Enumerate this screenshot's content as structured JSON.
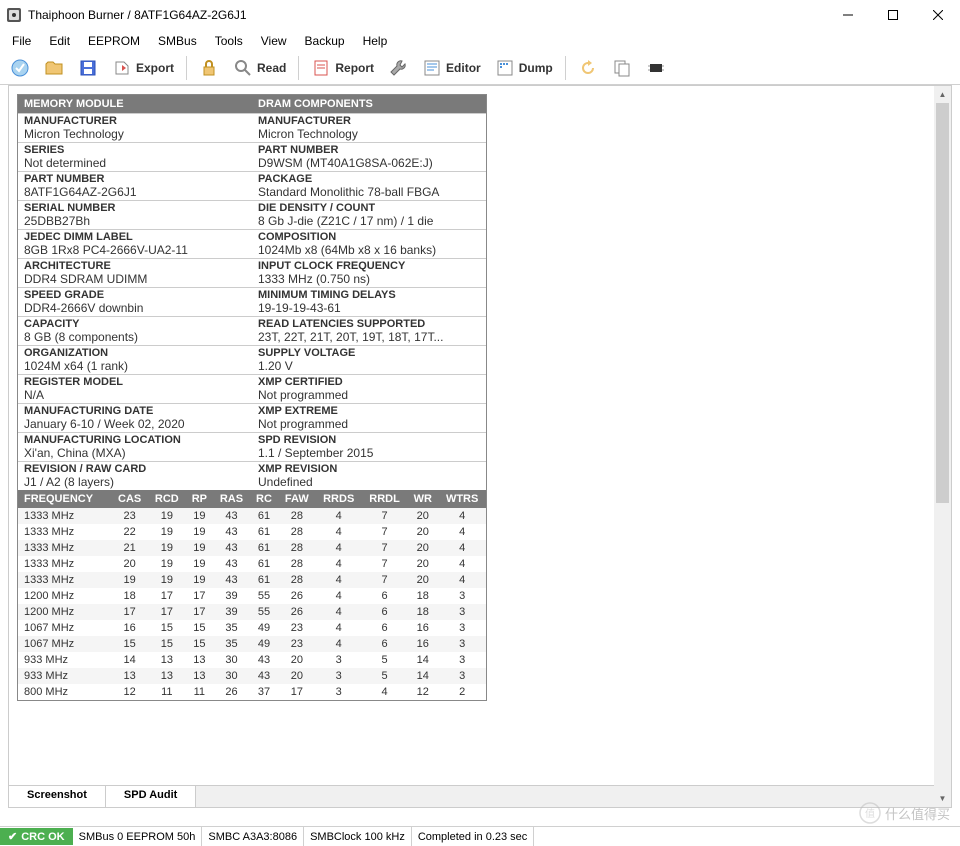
{
  "window": {
    "title": "Thaiphoon Burner / 8ATF1G64AZ-2G6J1"
  },
  "menu": [
    "File",
    "Edit",
    "EEPROM",
    "SMBus",
    "Tools",
    "View",
    "Backup",
    "Help"
  ],
  "toolbar": {
    "export_label": "Export",
    "read_label": "Read",
    "report_label": "Report",
    "editor_label": "Editor",
    "dump_label": "Dump"
  },
  "headers": {
    "memory_module": "MEMORY MODULE",
    "dram_components": "DRAM COMPONENTS"
  },
  "module": {
    "manufacturer": {
      "label": "MANUFACTURER",
      "value": "Micron Technology"
    },
    "series": {
      "label": "SERIES",
      "value": "Not determined"
    },
    "part_number": {
      "label": "PART NUMBER",
      "value": "8ATF1G64AZ-2G6J1"
    },
    "serial_number": {
      "label": "SERIAL NUMBER",
      "value": "25DBB27Bh"
    },
    "jedec_dimm_label": {
      "label": "JEDEC DIMM LABEL",
      "value": "8GB 1Rx8 PC4-2666V-UA2-11"
    },
    "architecture": {
      "label": "ARCHITECTURE",
      "value": "DDR4 SDRAM UDIMM"
    },
    "speed_grade": {
      "label": "SPEED GRADE",
      "value": "DDR4-2666V downbin"
    },
    "capacity": {
      "label": "CAPACITY",
      "value": "8 GB (8 components)"
    },
    "organization": {
      "label": "ORGANIZATION",
      "value": "1024M x64 (1 rank)"
    },
    "register_model": {
      "label": "REGISTER MODEL",
      "value": "N/A"
    },
    "manufacturing_date": {
      "label": "MANUFACTURING DATE",
      "value": "January 6-10 / Week 02, 2020"
    },
    "manufacturing_location": {
      "label": "MANUFACTURING LOCATION",
      "value": "Xi'an, China (MXA)"
    },
    "revision_raw_card": {
      "label": "REVISION / RAW CARD",
      "value": "J1 / A2 (8 layers)"
    }
  },
  "dram": {
    "manufacturer": {
      "label": "MANUFACTURER",
      "value": "Micron Technology"
    },
    "part_number": {
      "label": "PART NUMBER",
      "value": "D9WSM (MT40A1G8SA-062E:J)"
    },
    "package": {
      "label": "PACKAGE",
      "value": "Standard Monolithic 78-ball FBGA"
    },
    "die_density": {
      "label": "DIE DENSITY / COUNT",
      "value": "8 Gb J-die (Z21C / 17 nm) / 1 die"
    },
    "composition": {
      "label": "COMPOSITION",
      "value": "1024Mb x8 (64Mb x8 x 16 banks)"
    },
    "input_clock": {
      "label": "INPUT CLOCK FREQUENCY",
      "value": "1333 MHz (0.750 ns)"
    },
    "min_timing": {
      "label": "MINIMUM TIMING DELAYS",
      "value": "19-19-19-43-61"
    },
    "read_latencies": {
      "label": "READ LATENCIES SUPPORTED",
      "value": "23T, 22T, 21T, 20T, 19T, 18T, 17T..."
    },
    "supply_voltage": {
      "label": "SUPPLY VOLTAGE",
      "value": "1.20 V"
    },
    "xmp_certified": {
      "label": "XMP CERTIFIED",
      "value": "Not programmed"
    },
    "xmp_extreme": {
      "label": "XMP EXTREME",
      "value": "Not programmed"
    },
    "spd_revision": {
      "label": "SPD REVISION",
      "value": "1.1 / September 2015"
    },
    "xmp_revision": {
      "label": "XMP REVISION",
      "value": "Undefined"
    }
  },
  "timing_headers": [
    "FREQUENCY",
    "CAS",
    "RCD",
    "RP",
    "RAS",
    "RC",
    "FAW",
    "RRDS",
    "RRDL",
    "WR",
    "WTRS"
  ],
  "timing_rows": [
    [
      "1333 MHz",
      "23",
      "19",
      "19",
      "43",
      "61",
      "28",
      "4",
      "7",
      "20",
      "4"
    ],
    [
      "1333 MHz",
      "22",
      "19",
      "19",
      "43",
      "61",
      "28",
      "4",
      "7",
      "20",
      "4"
    ],
    [
      "1333 MHz",
      "21",
      "19",
      "19",
      "43",
      "61",
      "28",
      "4",
      "7",
      "20",
      "4"
    ],
    [
      "1333 MHz",
      "20",
      "19",
      "19",
      "43",
      "61",
      "28",
      "4",
      "7",
      "20",
      "4"
    ],
    [
      "1333 MHz",
      "19",
      "19",
      "19",
      "43",
      "61",
      "28",
      "4",
      "7",
      "20",
      "4"
    ],
    [
      "1200 MHz",
      "18",
      "17",
      "17",
      "39",
      "55",
      "26",
      "4",
      "6",
      "18",
      "3"
    ],
    [
      "1200 MHz",
      "17",
      "17",
      "17",
      "39",
      "55",
      "26",
      "4",
      "6",
      "18",
      "3"
    ],
    [
      "1067 MHz",
      "16",
      "15",
      "15",
      "35",
      "49",
      "23",
      "4",
      "6",
      "16",
      "3"
    ],
    [
      "1067 MHz",
      "15",
      "15",
      "15",
      "35",
      "49",
      "23",
      "4",
      "6",
      "16",
      "3"
    ],
    [
      "933 MHz",
      "14",
      "13",
      "13",
      "30",
      "43",
      "20",
      "3",
      "5",
      "14",
      "3"
    ],
    [
      "933 MHz",
      "13",
      "13",
      "13",
      "30",
      "43",
      "20",
      "3",
      "5",
      "14",
      "3"
    ],
    [
      "800 MHz",
      "12",
      "11",
      "11",
      "26",
      "37",
      "17",
      "3",
      "4",
      "12",
      "2"
    ]
  ],
  "bottom_tabs": {
    "screenshot": "Screenshot",
    "spd_audit": "SPD Audit"
  },
  "status": {
    "crc": "CRC OK",
    "smbus": "SMBus 0 EEPROM 50h",
    "smbc": "SMBC A3A3:8086",
    "smbclock": "SMBClock 100 kHz",
    "completed": "Completed in 0.23 sec"
  },
  "watermark": "什么值得买"
}
